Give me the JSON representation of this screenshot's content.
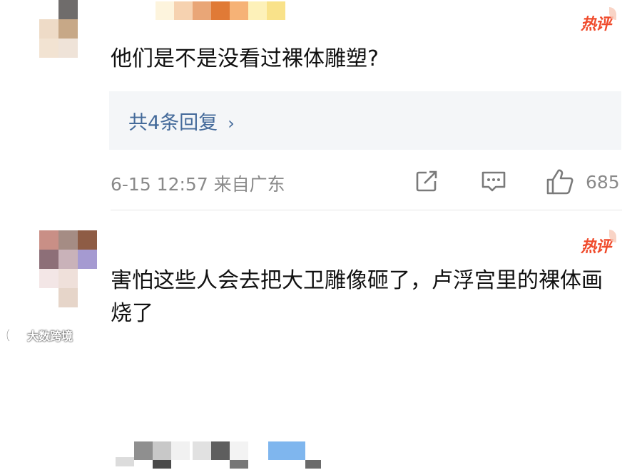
{
  "comments": [
    {
      "hot_label": "热评",
      "text": "他们是不是没看过裸体雕塑?",
      "replies_label": "共4条回复",
      "replies_chevron": "›",
      "meta": "6-15 12:57 来自广东",
      "like_count": "685"
    },
    {
      "hot_label": "热评",
      "text": "害怕这些人会去把大卫雕像砸了，卢浮宫里的裸体画烧了"
    }
  ],
  "watermark": "大数跨境",
  "colors": {
    "hot": "#f04b2c",
    "link": "#446a9a",
    "meta": "#8a8a8a",
    "reply_box": "#f4f6f8"
  },
  "icons": [
    "share-icon",
    "reply-icon",
    "thumbs-up-icon",
    "watermark-logo-icon"
  ]
}
